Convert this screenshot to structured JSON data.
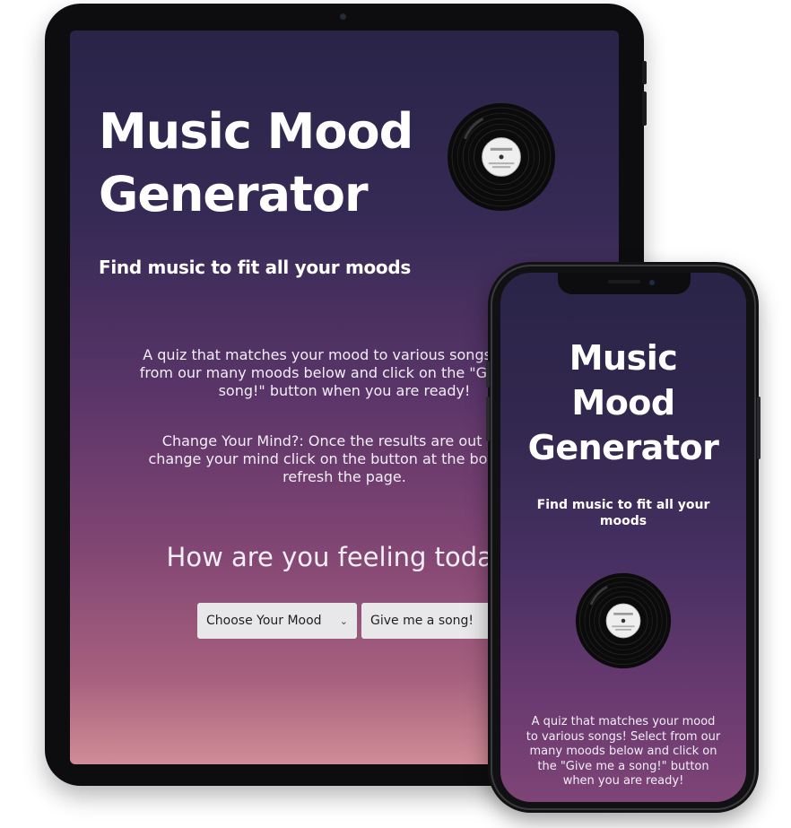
{
  "app": {
    "title": "Music Mood Generator",
    "subtitle": "Find music to fit all your moods",
    "description": "A quiz that matches your mood to various songs! Select from our many moods below and click on the \"Give me a song!\" button when you are ready!",
    "change_mind": "Change Your Mind?: Once the results are out if you change your mind click on the button at the bottom to refresh the page.",
    "question": "How are you feeling today?",
    "mood_select": {
      "value": "Choose Your Mood",
      "icon": "chevron-down-icon"
    },
    "submit_button": "Give me a song!"
  },
  "tablet": {
    "title": "Music Mood Generator",
    "subtitle": "Find music to fit all your moods",
    "desc_lines": [
      "A quiz that matches your mood to various songs! Select",
      "from our many moods below and click on the \"Give me a",
      "song!\" button when you are ready!"
    ],
    "change_lines": [
      "Change Your Mind?: Once the results are out if you",
      "change your mind click on the button at the bottom to",
      "refresh the page."
    ],
    "question": "How are you feeling today?",
    "select_value": "Choose Your Mood",
    "button_label": "Give me a song!"
  },
  "phone": {
    "title_lines": [
      "Music",
      "Mood",
      "Generator"
    ],
    "subtitle": "Find music to fit all your moods",
    "desc_lines": [
      "A quiz that matches your mood",
      "to various songs! Select from our",
      "many moods below and click on",
      "the \"Give me a song!\" button",
      "when you are ready!"
    ]
  },
  "colors": {
    "gradient_top": "#2a2448",
    "gradient_mid": "#804573",
    "gradient_bottom": "#d18c96",
    "text": "#ffffff",
    "control_bg": "#e8e8ea",
    "device_frame": "#0d0d0f"
  }
}
